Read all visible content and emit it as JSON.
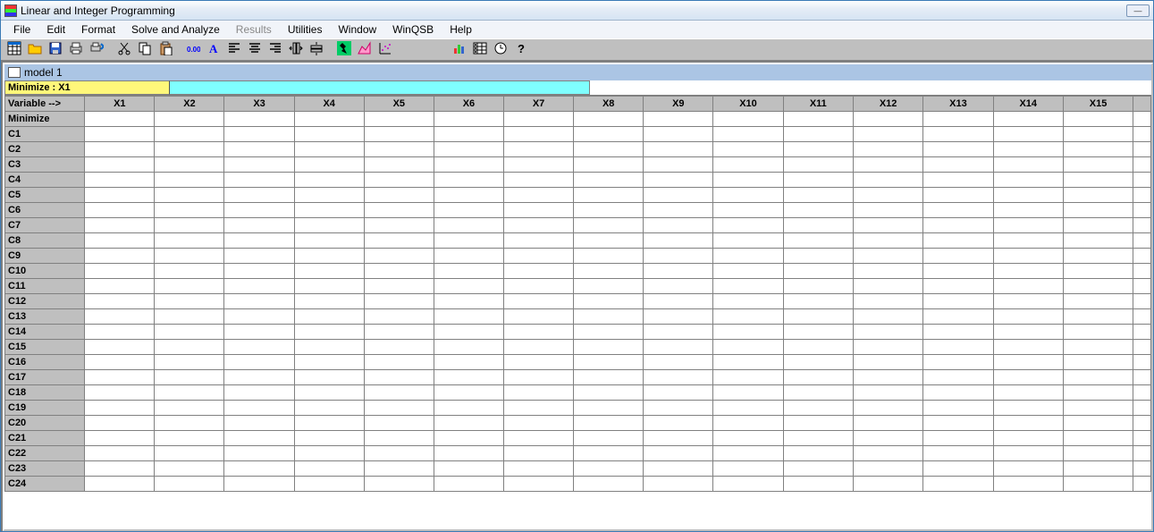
{
  "title": "Linear and Integer Programming",
  "menus": [
    "File",
    "Edit",
    "Format",
    "Solve and Analyze",
    "Results",
    "Utilities",
    "Window",
    "WinQSB",
    "Help"
  ],
  "disabled_menus": [
    "Results"
  ],
  "child_title": "model 1",
  "formula_label": "Minimize : X1",
  "corner_label": "Variable -->",
  "columns": [
    "X1",
    "X2",
    "X3",
    "X4",
    "X5",
    "X6",
    "X7",
    "X8",
    "X9",
    "X10",
    "X11",
    "X12",
    "X13",
    "X14",
    "X15"
  ],
  "rows": [
    "Minimize",
    "C1",
    "C2",
    "C3",
    "C4",
    "C5",
    "C6",
    "C7",
    "C8",
    "C9",
    "C10",
    "C11",
    "C12",
    "C13",
    "C14",
    "C15",
    "C16",
    "C17",
    "C18",
    "C19",
    "C20",
    "C21",
    "C22",
    "C23",
    "C24"
  ],
  "toolbar_icons": [
    "grid",
    "open",
    "save",
    "print",
    "print-preview",
    "sep",
    "cut",
    "copy",
    "paste",
    "sep",
    "number-format",
    "font",
    "align-left",
    "align-center",
    "align-right",
    "column-width",
    "row-height",
    "sep",
    "run",
    "chart-area",
    "chart-scatter",
    "sep2",
    "chart-bar",
    "table-view",
    "clock",
    "help"
  ]
}
